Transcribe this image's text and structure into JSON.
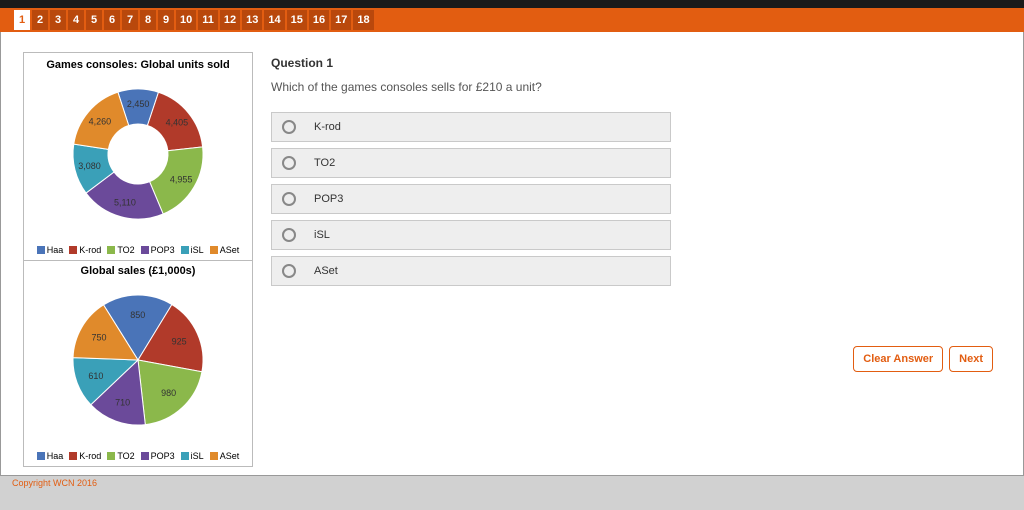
{
  "tabs": {
    "count": 18,
    "current": 1
  },
  "question": {
    "heading": "Question 1",
    "text": "Which of the games consoles sells for £210 a unit?",
    "answers": [
      {
        "label": "K-rod"
      },
      {
        "label": "TO2"
      },
      {
        "label": "POP3"
      },
      {
        "label": "iSL"
      },
      {
        "label": "ASet"
      }
    ]
  },
  "buttons": {
    "clear": "Clear Answer",
    "next": "Next"
  },
  "copyright": "Copyright WCN 2016",
  "chart_data": [
    {
      "type": "pie",
      "title": "Games consoles: Global units sold",
      "donut": true,
      "series": [
        {
          "name": "Haa",
          "value": 2450,
          "color": "#4a74b8"
        },
        {
          "name": "K-rod",
          "value": 4405,
          "color": "#b13a2a"
        },
        {
          "name": "TO2",
          "value": 4955,
          "color": "#8bb84b"
        },
        {
          "name": "POP3",
          "value": 5110,
          "color": "#6b4a9a"
        },
        {
          "name": "iSL",
          "value": 3080,
          "color": "#3aa0b8"
        },
        {
          "name": "ASet",
          "value": 4260,
          "color": "#e08a2b"
        }
      ]
    },
    {
      "type": "pie",
      "title": "Global sales (£1,000s)",
      "donut": false,
      "series": [
        {
          "name": "Haa",
          "value": 850,
          "color": "#4a74b8"
        },
        {
          "name": "K-rod",
          "value": 925,
          "color": "#b13a2a"
        },
        {
          "name": "TO2",
          "value": 980,
          "color": "#8bb84b"
        },
        {
          "name": "POP3",
          "value": 710,
          "color": "#6b4a9a"
        },
        {
          "name": "iSL",
          "value": 610,
          "color": "#3aa0b8"
        },
        {
          "name": "ASet",
          "value": 750,
          "color": "#e08a2b"
        }
      ]
    }
  ]
}
